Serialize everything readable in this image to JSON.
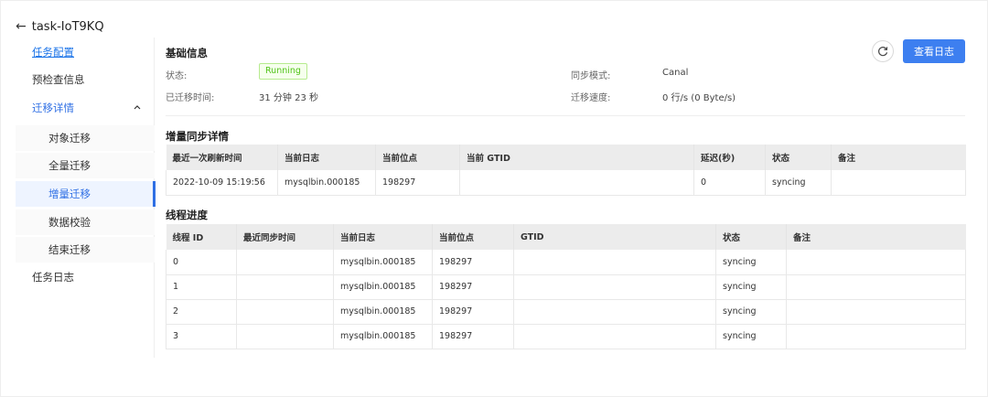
{
  "header": {
    "back_icon": "arrow-left-icon",
    "title": "task-IoT9KQ"
  },
  "sidebar": {
    "items": [
      {
        "label": "任务配置"
      },
      {
        "label": "预检查信息"
      },
      {
        "label": "迁移详情",
        "icon": "chevron-up-icon"
      },
      {
        "label": "对象迁移"
      },
      {
        "label": "全量迁移"
      },
      {
        "label": "增量迁移"
      },
      {
        "label": "数据校验"
      },
      {
        "label": "结束迁移"
      },
      {
        "label": "任务日志"
      }
    ]
  },
  "basic_info": {
    "title": "基础信息",
    "status_label": "状态:",
    "status_value": "Running",
    "elapsed_label": "已迁移时间:",
    "elapsed_value": "31 分钟 23 秒",
    "sync_mode_label": "同步模式:",
    "sync_mode_value": "Canal",
    "speed_label": "迁移速度:",
    "speed_value": "0 行/s (0 Byte/s)"
  },
  "actions": {
    "refresh_icon": "refresh-icon",
    "view_logs_label": "查看日志"
  },
  "incremental": {
    "title": "增量同步详情",
    "columns": [
      "最近一次刷新时间",
      "当前日志",
      "当前位点",
      "当前 GTID",
      "延迟(秒)",
      "状态",
      "备注"
    ],
    "rows": [
      [
        "2022-10-09 15:19:56",
        "mysqlbin.000185",
        "198297",
        "",
        "0",
        "syncing",
        ""
      ]
    ]
  },
  "threads": {
    "title": "线程进度",
    "columns": [
      "线程 ID",
      "最近同步时间",
      "当前日志",
      "当前位点",
      "GTID",
      "状态",
      "备注"
    ],
    "rows": [
      [
        "0",
        "",
        "mysqlbin.000185",
        "198297",
        "",
        "syncing",
        ""
      ],
      [
        "1",
        "",
        "mysqlbin.000185",
        "198297",
        "",
        "syncing",
        ""
      ],
      [
        "2",
        "",
        "mysqlbin.000185",
        "198297",
        "",
        "syncing",
        ""
      ],
      [
        "3",
        "",
        "mysqlbin.000185",
        "198297",
        "",
        "syncing",
        ""
      ]
    ]
  },
  "colors": {
    "accent": "#3d7ff0",
    "status_green": "#52c41a"
  }
}
